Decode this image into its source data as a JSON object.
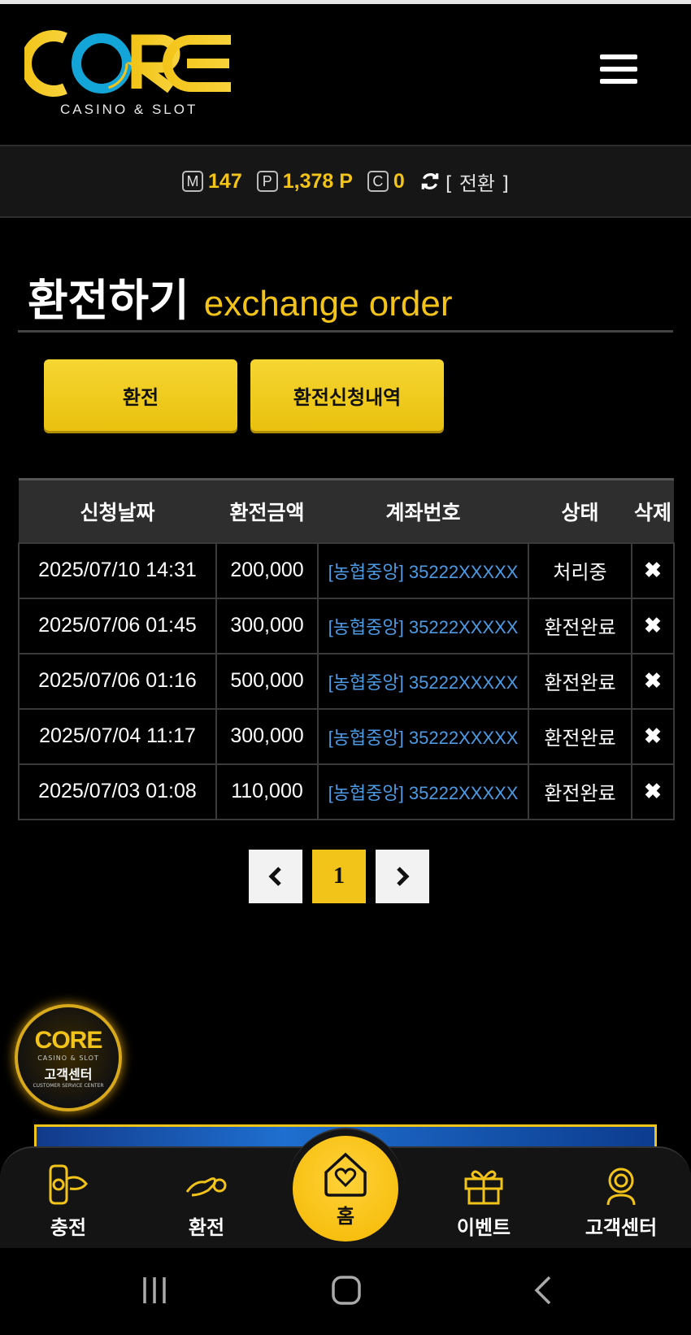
{
  "brand": {
    "logo_text": "CORE",
    "logo_sub": "CASINO & SLOT"
  },
  "balance": {
    "m_icon": "M",
    "m_value": "147",
    "p_icon": "P",
    "p_value": "1,378 P",
    "c_icon": "C",
    "c_value": "0",
    "convert_label": "[ 전환 ]"
  },
  "page": {
    "title_ko": "환전하기",
    "title_en": "exchange order"
  },
  "tabs": {
    "exchange": "환전",
    "history": "환전신청내역"
  },
  "table": {
    "headers": [
      "신청날짜",
      "환전금액",
      "계좌번호",
      "상태",
      "삭제"
    ],
    "rows": [
      {
        "date": "2025/07/10 14:31",
        "amount": "200,000",
        "account": "[농협중앙] 35222XXXXX",
        "status": "처리중"
      },
      {
        "date": "2025/07/06 01:45",
        "amount": "300,000",
        "account": "[농협중앙] 35222XXXXX",
        "status": "환전완료"
      },
      {
        "date": "2025/07/06 01:16",
        "amount": "500,000",
        "account": "[농협중앙] 35222XXXXX",
        "status": "환전완료"
      },
      {
        "date": "2025/07/04 11:17",
        "amount": "300,000",
        "account": "[농협중앙] 35222XXXXX",
        "status": "환전완료"
      },
      {
        "date": "2025/07/03 01:08",
        "amount": "110,000",
        "account": "[농협중앙] 35222XXXXX",
        "status": "환전완료"
      }
    ],
    "delete_icon": "✖"
  },
  "pagination": {
    "prev": "‹",
    "current": "1",
    "next": "›"
  },
  "cs_badge": {
    "logo": "CORE",
    "sub": "CASINO & SLOT",
    "label_ko": "고객센터",
    "label_en": "CUSTOMER SERVICE CENTER"
  },
  "bottom_nav": {
    "deposit": "충전",
    "exchange": "환전",
    "home": "홈",
    "event": "이벤트",
    "support": "고객센터"
  },
  "colors": {
    "accent": "#f2c319",
    "link": "#4b9be6",
    "bg": "#000000"
  }
}
